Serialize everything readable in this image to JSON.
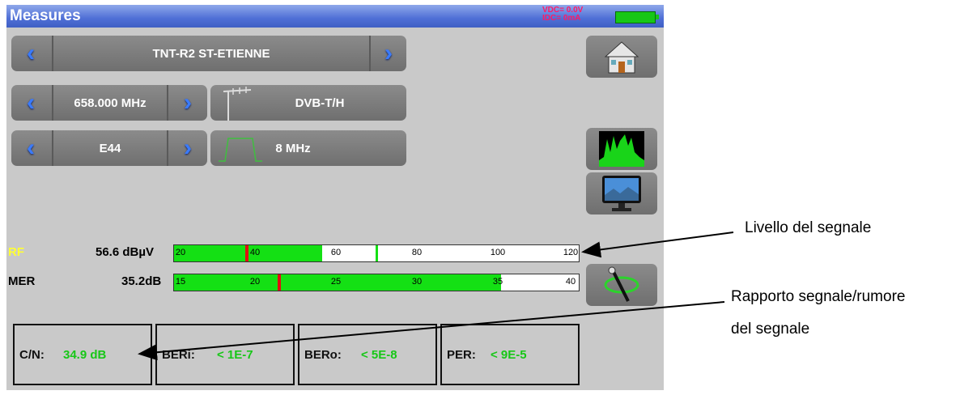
{
  "header": {
    "title": "Measures",
    "vdc": "VDC= 0.0V",
    "idc": "IDC= 0mA"
  },
  "channel_row": {
    "label": "TNT-R2 ST-ETIENNE"
  },
  "frequency_row": {
    "value": "658.000 MHz",
    "standard": "DVB-T/H"
  },
  "channel_num_row": {
    "value": "E44",
    "bandwidth": "8 MHz"
  },
  "rf": {
    "label": "RF",
    "value": "56.6 dBµV",
    "ticks": [
      "20",
      "40",
      "60",
      "80",
      "100",
      "120"
    ],
    "range": [
      20,
      120
    ],
    "fill_value": 56.6,
    "peak_value": 38,
    "target_value": 70
  },
  "mer": {
    "label": "MER",
    "value": "35.2dB",
    "ticks": [
      "15",
      "20",
      "25",
      "30",
      "35",
      "40"
    ],
    "range": [
      15,
      40
    ],
    "fill_value": 35.2,
    "peak_value": 21.5
  },
  "measures": [
    {
      "label": "C/N:",
      "value": "34.9 dB"
    },
    {
      "label": "BERi:",
      "value": "< 1E-7"
    },
    {
      "label": "BERo:",
      "value": "< 5E-8"
    },
    {
      "label": "PER:",
      "value": "< 9E-5"
    }
  ],
  "annotations": {
    "signal_level": "Livello del segnale",
    "snr_line1": "Rapporto segnale/rumore",
    "snr_line2": "del segnale"
  },
  "colors": {
    "accent_blue": "#3a7bff",
    "bar_green": "#14e014",
    "marker_red": "#e01010",
    "value_green": "#17c717",
    "title_bar": "#4f6fd6"
  },
  "icons": [
    "chevron-left-icon",
    "chevron-right-icon",
    "home-icon",
    "antenna-icon",
    "bandwidth-icon",
    "spectrum-icon",
    "tv-icon",
    "pointer-tool-icon",
    "battery-icon"
  ]
}
